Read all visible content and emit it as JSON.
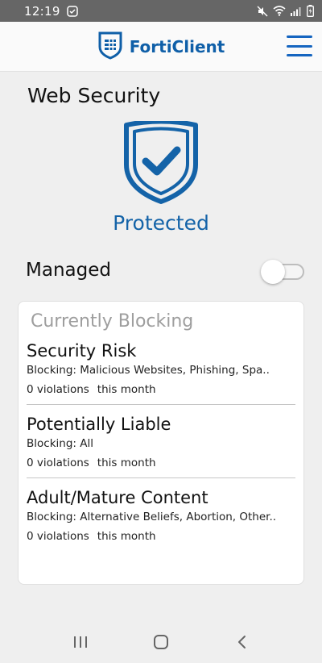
{
  "status_bar": {
    "time": "12:19"
  },
  "app_bar": {
    "brand_name": "FortiClient",
    "menu_icon": "hamburger-menu-icon"
  },
  "web_security": {
    "title": "Web Security",
    "status": "Protected",
    "status_color": "#1463a8",
    "shield_icon": "shield-check-icon"
  },
  "managed": {
    "label": "Managed",
    "enabled": false
  },
  "blocking": {
    "title": "Currently Blocking",
    "categories": [
      {
        "name": "Security Risk",
        "blocking": "Blocking: Malicious Websites, Phishing, Spa..",
        "violations": "0 violations",
        "period": "this month"
      },
      {
        "name": "Potentially Liable",
        "blocking": "Blocking: All",
        "violations": "0 violations",
        "period": "this month"
      },
      {
        "name": "Adult/Mature Content",
        "blocking": "Blocking: Alternative Beliefs, Abortion, Other..",
        "violations": "0 violations",
        "period": "this month"
      }
    ]
  },
  "colors": {
    "brand": "#0f5fa8",
    "accent": "#1565c0",
    "status_bar": "#666666",
    "background": "#efefef"
  }
}
